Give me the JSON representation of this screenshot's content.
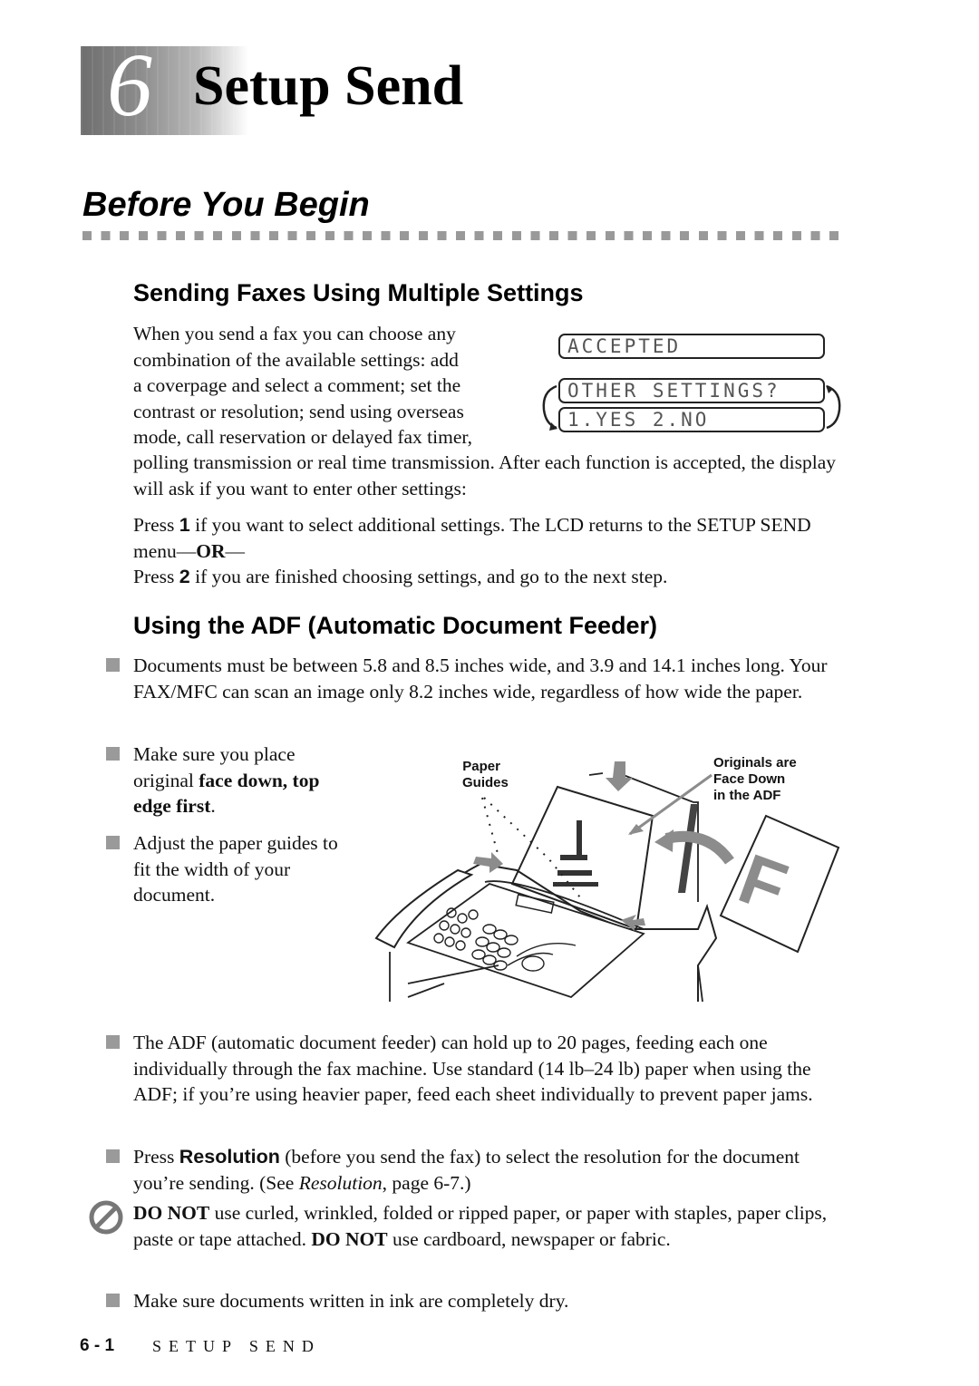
{
  "chapter": {
    "number": "6",
    "title": "Setup Send"
  },
  "section": {
    "title": "Before You Begin"
  },
  "multiple_settings": {
    "heading": "Sending Faxes Using Multiple Settings",
    "intro_lines": [
      "When you send a fax you can choose any",
      "combination of the available settings:  add",
      "a coverpage and select a comment; set the",
      "contrast or resolution; send using overseas",
      "mode, call reservation or delayed fax timer,"
    ],
    "continuation": "polling transmission or real time transmission. After each function is accepted, the display will ask if you want to enter other settings:",
    "lcd": {
      "line1": "ACCEPTED",
      "line2": "OTHER SETTINGS?",
      "line3": "1.YES 2.NO"
    },
    "press1": {
      "pre": "Press ",
      "key": "1",
      "post": " if you want to select additional settings. The LCD returns to the SETUP SEND menu—",
      "or": "OR",
      "dash": "—"
    },
    "press2": {
      "pre": "Press ",
      "key": "2",
      "post": " if you are finished choosing settings, and go to the next step."
    }
  },
  "adf": {
    "heading": "Using the ADF (Automatic Document Feeder)",
    "bullet1": "Documents must be between 5.8 and 8.5 inches wide, and 3.9 and 14.1 inches long. Your FAX/MFC can scan an image only 8.2 inches wide, regardless of how wide the paper.",
    "bullet2": {
      "pre": "Make sure you place original ",
      "bold": "face down, top edge first",
      "post": "."
    },
    "bullet3": "Adjust the paper guides to fit the width of your document.",
    "figure": {
      "label_guides_1": "Paper",
      "label_guides_2": "Guides",
      "label_originals_1": "Originals are",
      "label_originals_2": "Face Down",
      "label_originals_3": "in the ADF",
      "sheet_letter": "F"
    },
    "bullet4": "The ADF (automatic document feeder) can hold up to 20 pages, feeding each one individually through the fax machine. Use standard (14 lb–24 lb) paper when using the ADF; if you’re using heavier paper, feed each sheet individually to prevent paper jams.",
    "bullet5": {
      "pre": "Press ",
      "key": "Resolution",
      "mid": " (before you send the fax) to select the resolution for the document you’re sending. (See ",
      "ref": "Resolution",
      "post": ", page 6-7.)"
    },
    "warning": {
      "bold1": "DO NOT",
      "text1": " use curled, wrinkled, folded or ripped paper, or paper with staples, paper clips, paste or tape attached. ",
      "bold2": "DO NOT",
      "text2": " use cardboard, newspaper or fabric."
    },
    "bullet6": "Make sure documents written in ink are completely dry."
  },
  "footer": {
    "page": "6 - 1",
    "label": "SETUP SEND"
  }
}
